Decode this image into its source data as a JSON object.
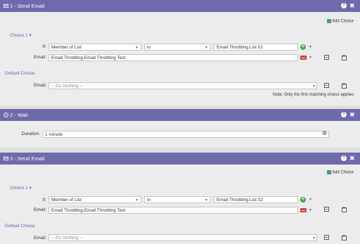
{
  "add_choice_label": "Add Choice",
  "colors": {
    "header": "#6e6aab",
    "link": "#5a68b8",
    "green": "#4ca64c",
    "red": "#c9403c"
  },
  "steps": [
    {
      "title": "1 - Send Email",
      "icon": "envelope-icon",
      "choice_label": "Choice 1 ▾",
      "if_label": "If:",
      "condition_field": "Member of List",
      "condition_operator": "in",
      "condition_value": "Email Throttling.List 01",
      "email_label": "Email:",
      "email_value": "Email Throttling.Email Throttling Test",
      "default_choice_label": "Default Choice",
      "default_email_label": "Email:",
      "default_email_value": "-- Do Nothing --",
      "note": "Note: Only the first matching choice applies"
    },
    {
      "title": "2 - Wait",
      "icon": "clock-icon",
      "duration_label": "Duration:",
      "duration_value": "1 minute"
    },
    {
      "title": "3 - Send Email",
      "icon": "envelope-icon",
      "choice_label": "Choice 1 ▾",
      "if_label": "If:",
      "condition_field": "Member of List",
      "condition_operator": "in",
      "condition_value": "Email Throttling.List 02",
      "email_label": "Email:",
      "email_value": "Email Throttling.Email Throttling Test",
      "default_choice_label": "Default Choice",
      "default_email_label": "Email:",
      "default_email_value": "-- Do Nothing --"
    }
  ],
  "header_help": "?",
  "header_close": "✖"
}
